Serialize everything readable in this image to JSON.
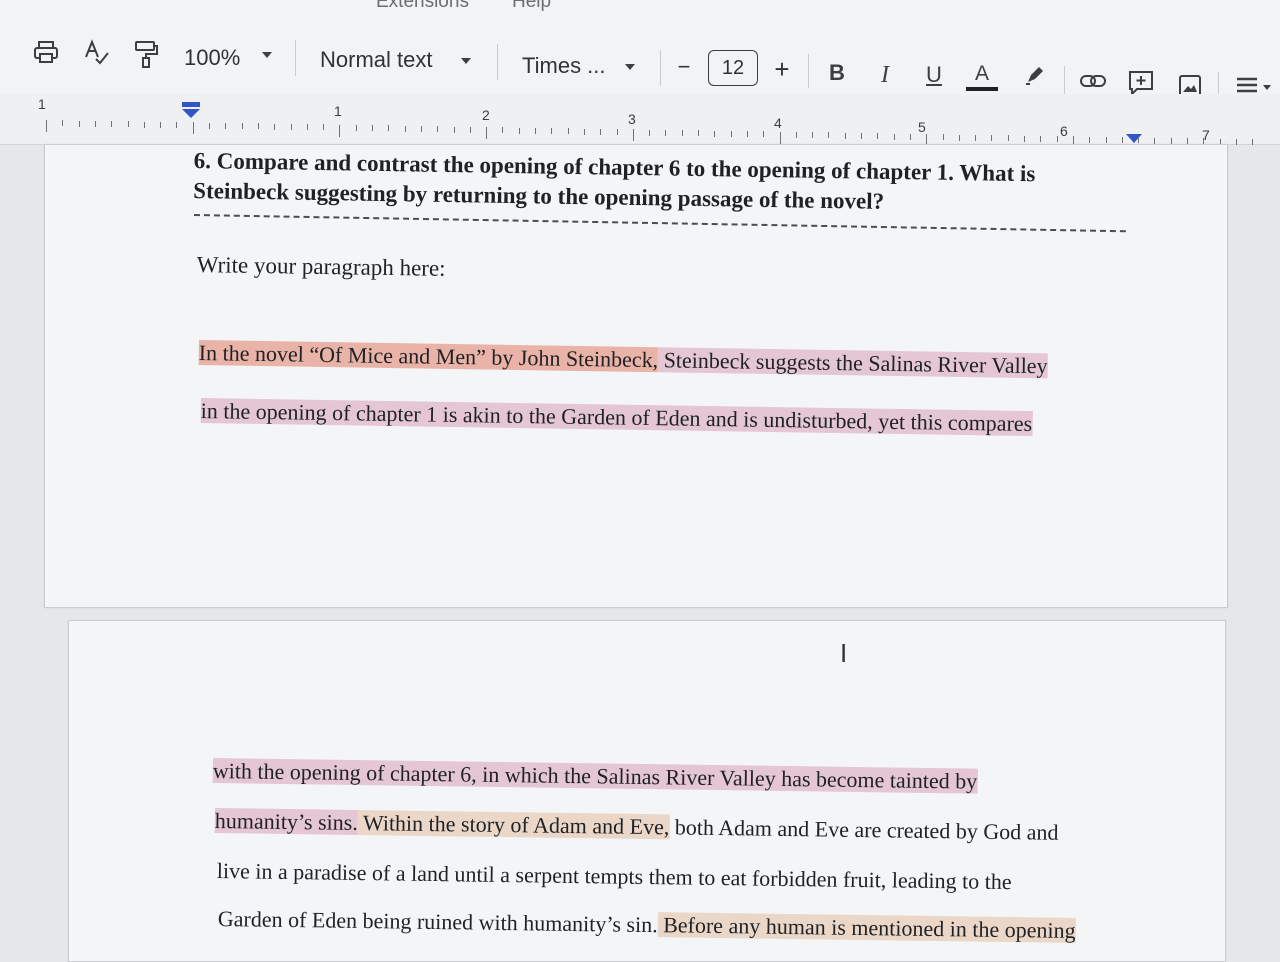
{
  "menubar": {
    "items": [
      "Extensions",
      "Help"
    ]
  },
  "toolbar": {
    "zoom": "100%",
    "paragraph_style": "Normal text",
    "font_name": "Times ...",
    "font_size": "12",
    "decrease_label": "−",
    "increase_label": "+",
    "bold_label": "B",
    "italic_label": "I",
    "underline_label": "U",
    "text_color_label": "A",
    "icons": [
      "print-icon",
      "spellcheck-icon",
      "paint-format-icon",
      "highlighter-icon",
      "link-icon",
      "add-comment-icon",
      "insert-image-icon",
      "align-icon"
    ]
  },
  "ruler": {
    "left_marker": "1",
    "numbers": [
      "1",
      "2",
      "3",
      "4",
      "5",
      "6",
      "7"
    ]
  },
  "document": {
    "question": "6. Compare and contrast the opening of chapter 6 to the opening of chapter 1. What is",
    "question_cont": "Steinbeck suggesting by returning to the opening passage of the novel?",
    "prompt": "Write your paragraph here:",
    "page1_lines": [
      {
        "a": "In the novel “Of Mice and Men” by John Steinbeck,",
        "b": " Steinbeck suggests the Salinas River Valley"
      },
      {
        "a": "in the opening of chapter 1 is akin to the Garden of Eden and is undisturbed, yet this compares"
      }
    ],
    "page2_lines": [
      {
        "a": "with the opening of chapter 6, in which the Salinas River Valley has become tainted by"
      },
      {
        "a": "humanity’s sins.",
        "b": " Within the story of Adam and Eve,",
        "c": " both Adam and Eve are created by God and"
      },
      {
        "a": "live in a paradise of a land until a serpent tempts them to eat forbidden fruit, leading to the"
      },
      {
        "a": "Garden of Eden being ruined with humanity’s sin.",
        "b": " Before any human is mentioned in the opening"
      }
    ]
  },
  "colors": {
    "highlight_salmon": "#e9b3a8",
    "highlight_pink": "#e4c7d2",
    "highlight_peach": "#ead7c8"
  }
}
